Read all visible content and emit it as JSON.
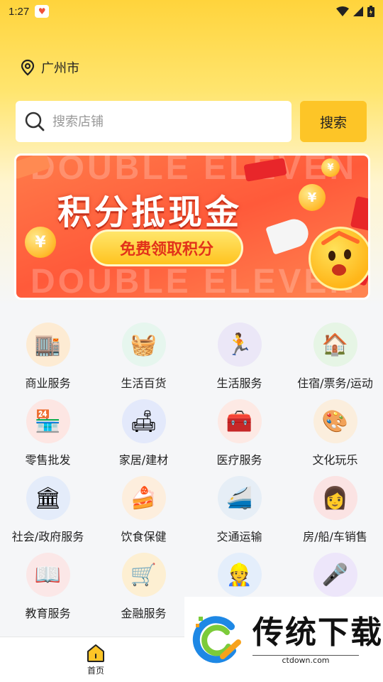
{
  "status_bar": {
    "time": "1:27",
    "icons": [
      "app-heart-icon",
      "wifi-icon",
      "signal-icon",
      "battery-icon"
    ]
  },
  "location": {
    "city": "广州市",
    "icon": "location-pin-icon"
  },
  "search": {
    "placeholder": "搜索店铺",
    "button_label": "搜索"
  },
  "banner": {
    "title": "积分抵现金",
    "button_label": "免费领取积分",
    "background_text": "DOUBLE ELEVEN"
  },
  "categories": [
    {
      "label": "商业服务",
      "icon": "shop-building-icon",
      "color": "#fdebd3"
    },
    {
      "label": "生活百货",
      "icon": "shopping-basket-icon",
      "color": "#e6f6ee"
    },
    {
      "label": "生活服务",
      "icon": "treadmill-icon",
      "color": "#ebe7f7"
    },
    {
      "label": "住宿/票务/运动",
      "icon": "house-pin-icon",
      "color": "#e6f5e5"
    },
    {
      "label": "零售批发",
      "icon": "storefront-icon",
      "color": "#fde6e3"
    },
    {
      "label": "家居/建材",
      "icon": "sofa-icon",
      "color": "#e3e9fb"
    },
    {
      "label": "医疗服务",
      "icon": "medical-kit-icon",
      "color": "#fde9e4"
    },
    {
      "label": "文化玩乐",
      "icon": "paint-palette-icon",
      "color": "#fbeedd"
    },
    {
      "label": "社会/政府服务",
      "icon": "government-building-icon",
      "color": "#e4ecfa"
    },
    {
      "label": "饮食保健",
      "icon": "cake-icon",
      "color": "#fdeedd"
    },
    {
      "label": "交通运输",
      "icon": "train-icon",
      "color": "#e6eef6"
    },
    {
      "label": "房/船/车销售",
      "icon": "agent-woman-icon",
      "color": "#fbe3e3"
    },
    {
      "label": "教育服务",
      "icon": "book-icon",
      "color": "#fbe7e7"
    },
    {
      "label": "金融服务",
      "icon": "coin-cart-icon",
      "color": "#fdefd2"
    },
    {
      "label": "",
      "icon": "worker-icon",
      "color": "#e4eefb"
    },
    {
      "label": "",
      "icon": "microphone-icon",
      "color": "#ede6fa"
    }
  ],
  "bottom_nav": {
    "home_label": "首页",
    "home_icon": "home-icon"
  },
  "watermark": {
    "title": "传统下载",
    "url": "ctdown.com",
    "logo": "ctdown-logo-icon"
  },
  "colors": {
    "accent": "#fdc527",
    "banner_red": "#ff5a3a"
  }
}
